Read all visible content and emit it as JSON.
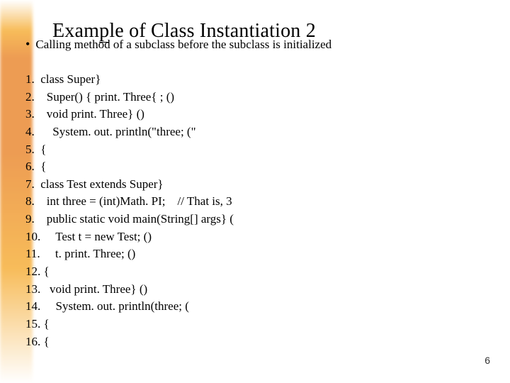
{
  "title": {
    "prefix": "Exam",
    "underlined_first": "p",
    "mid": "le of Class Instantiation 2"
  },
  "bullet": "Calling method of a subclass before the subclass is initialized",
  "code_lines": [
    "1.  class Super}",
    "2.    Super() { print. Three{ ; ()",
    "3.    void print. Three} ()",
    "4.      System. out. println(\"three; (\"",
    "5.  {",
    "6.  {",
    "7.  class Test extends Super}",
    "8.    int three = (int)Math. PI;    // That is, 3",
    "9.    public static void main(String[] args} (",
    "10.     Test t = new Test; ()",
    "11.     t. print. Three; ()",
    "12. {",
    "13.   void print. Three} ()",
    "14.     System. out. println(three; (",
    "15. {",
    "16. {"
  ],
  "page_number": "6"
}
